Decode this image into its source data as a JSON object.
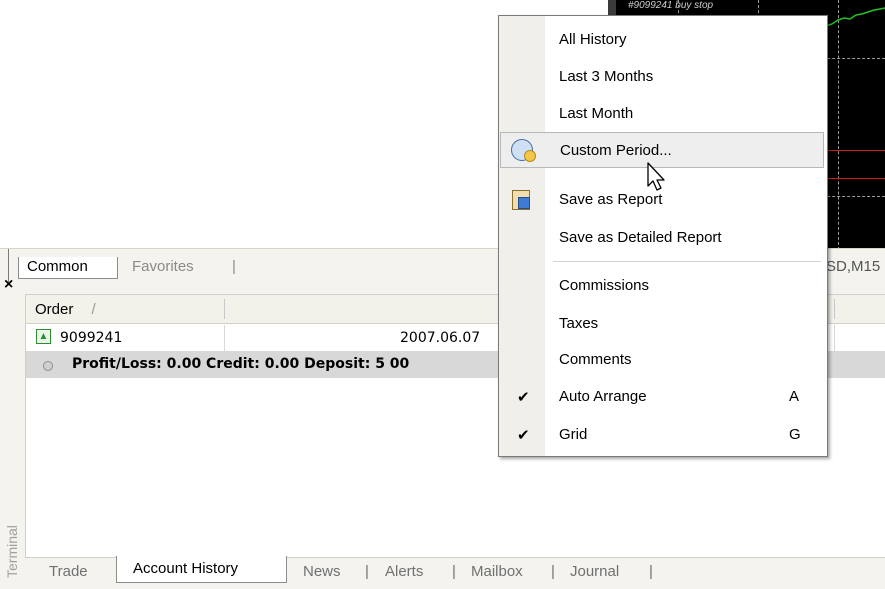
{
  "chart": {
    "label": "#9099241 buy stop"
  },
  "upper_tabs": {
    "common": "Common",
    "favorites": "Favorites",
    "separator": "|",
    "symbol_tag": "SD,M15"
  },
  "terminal": {
    "close_symbol": "×",
    "vertical_label": "Terminal",
    "columns": {
      "order": "Order",
      "sort_marker": "/"
    },
    "order_row": {
      "id": "9099241",
      "time": "2007.06.07",
      "direction_icon": "buy-arrow-icon"
    },
    "summary_text": "Profit/Loss: 0.00  Credit: 0.00  Deposit: 5 00",
    "bottom_tabs": {
      "trade": "Trade",
      "account_history": "Account History",
      "news": "News",
      "alerts": "Alerts",
      "mailbox": "Mailbox",
      "journal": "Journal",
      "separator": "|"
    }
  },
  "context_menu": {
    "all_history": "All History",
    "last_3_months": "Last 3 Months",
    "last_month": "Last Month",
    "custom_period": "Custom Period...",
    "save_as_report": "Save as Report",
    "save_as_detailed_report": "Save as Detailed Report",
    "commissions": "Commissions",
    "taxes": "Taxes",
    "comments": "Comments",
    "auto_arrange": "Auto Arrange",
    "auto_arrange_key": "A",
    "grid": "Grid",
    "grid_key": "G",
    "checkmark": "✔"
  }
}
